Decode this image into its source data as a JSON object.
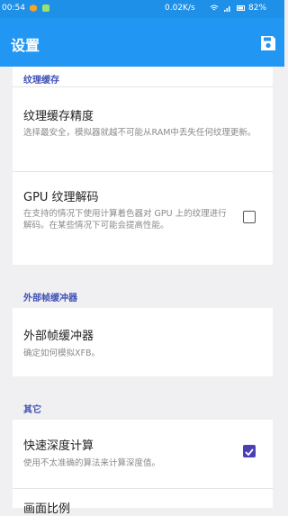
{
  "status_bar": {
    "time": "00:54",
    "network_speed": "0.02K/s",
    "battery": "82%",
    "icons": [
      "notification-icon",
      "wifi-icon",
      "signal-icon",
      "battery-icon"
    ]
  },
  "app_bar": {
    "title": "设置",
    "save_icon": "save-icon"
  },
  "sections": {
    "texture_cache": {
      "header": "纹理缓存",
      "items": [
        {
          "title": "纹理缓存精度",
          "desc": "选择最安全，模拟器就越不可能从RAM中丢失任何纹理更新。"
        },
        {
          "title": "GPU 纹理解码",
          "desc": "在支持的情况下使用计算着色器对 GPU 上的纹理进行解码。在某些情况下可能会提高性能。",
          "checked": false
        }
      ]
    },
    "efb": {
      "header": "外部帧缓冲器",
      "items": [
        {
          "title": "外部帧缓冲器",
          "desc": "确定如何模拟XFB。"
        }
      ]
    },
    "other": {
      "header": "其它",
      "items": [
        {
          "title": "快速深度计算",
          "desc": "使用不太准确的算法来计算深度值。",
          "checked": true
        },
        {
          "title": "画面比例"
        }
      ]
    }
  },
  "colors": {
    "status_bar": "#1e90e8",
    "app_bar": "#2196f3",
    "section_header": "#3f51b5",
    "checkbox_checked": "#4a3fb5",
    "background": "#f0f0f2"
  }
}
